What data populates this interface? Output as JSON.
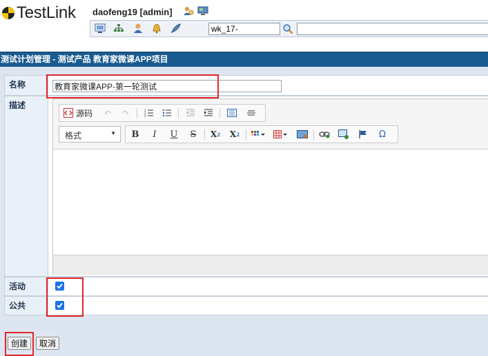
{
  "app": {
    "logo_text": "TestLink"
  },
  "header": {
    "user_label": "daofeng19 [admin]"
  },
  "toolbar": {
    "icons": [
      "desktop-icon",
      "sitemap-icon",
      "user-icon",
      "bell-icon",
      "feather-icon"
    ],
    "search_value": "wk_17-",
    "search_icon": "magnifier-icon",
    "wide_input_value": ""
  },
  "page": {
    "title": "测试计划管理 - 测试产品 教育家微课APP项目"
  },
  "form": {
    "name_label": "名称",
    "name_value": "教育家微课APP-第一轮测试",
    "description_label": "描述",
    "active_label": "活动",
    "public_label": "公共",
    "active_checked": true,
    "public_checked": true
  },
  "editor": {
    "source_label": "源码",
    "format_label": "格式"
  },
  "buttons": {
    "create": "创建",
    "cancel": "取消"
  },
  "colors": {
    "title_bar": "#1a5b8f",
    "highlight": "#e0262b",
    "checkbox": "#1a73e8"
  }
}
